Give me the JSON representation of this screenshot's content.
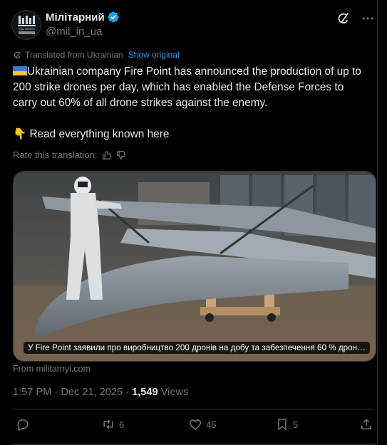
{
  "header": {
    "account_name": "Мілітарний",
    "handle": "@mil_in_ua",
    "avatar_text": "MILITARNYI",
    "verified_icon": "verified-badge-icon",
    "grok_icon": "grok-icon",
    "more_icon": "more-icon"
  },
  "translation": {
    "notice": "Translated from Ukrainian",
    "show_original": "Show original",
    "rate_label": "Rate this translation:"
  },
  "post": {
    "paragraph1": "Ukrainian company Fire Point has announced the production of up to 200 strike drones per day, which has enabled the Defense Forces to carry out 60% of all drone strikes against the enemy.",
    "paragraph2_emoji": "👇",
    "paragraph2": "Read everything known here"
  },
  "card": {
    "caption": "У Fire Point заявили про виробництво 200 дронів на добу та забезпечення 60 % дрон…",
    "source": "From militarnyi.com"
  },
  "meta": {
    "time": "1:57 PM · Dec 21, 2025 · ",
    "views_count": "1,549",
    "views_label": " Views"
  },
  "actions": {
    "replies": "",
    "reposts": "6",
    "likes": "45",
    "bookmarks": "5"
  },
  "colors": {
    "background": "#000000",
    "text": "#e7e9ea",
    "muted": "#71767b",
    "accent": "#1d9bf0",
    "divider": "#2f3336"
  }
}
